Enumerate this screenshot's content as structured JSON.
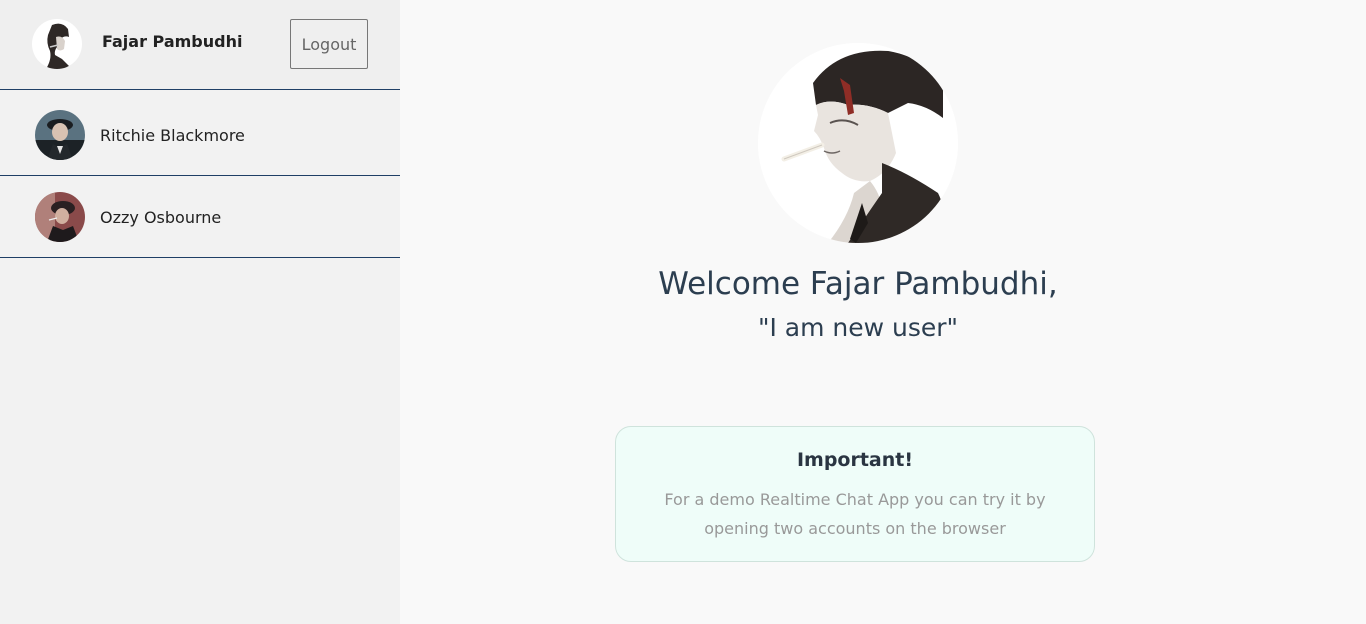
{
  "current_user": {
    "name": "Fajar Pambudhi",
    "logout_label": "Logout"
  },
  "contacts": [
    {
      "name": "Ritchie Blackmore"
    },
    {
      "name": "Ozzy Osbourne"
    }
  ],
  "main": {
    "welcome": "Welcome Fajar Pambudhi,",
    "status": "\"I am new user\""
  },
  "notice": {
    "title": "Important!",
    "body": "For a demo Realtime Chat App you can try it by opening two accounts on the browser"
  },
  "colors": {
    "divider": "#1f3f66",
    "notice_bg": "#effdf9",
    "heading": "#2c3e50"
  }
}
